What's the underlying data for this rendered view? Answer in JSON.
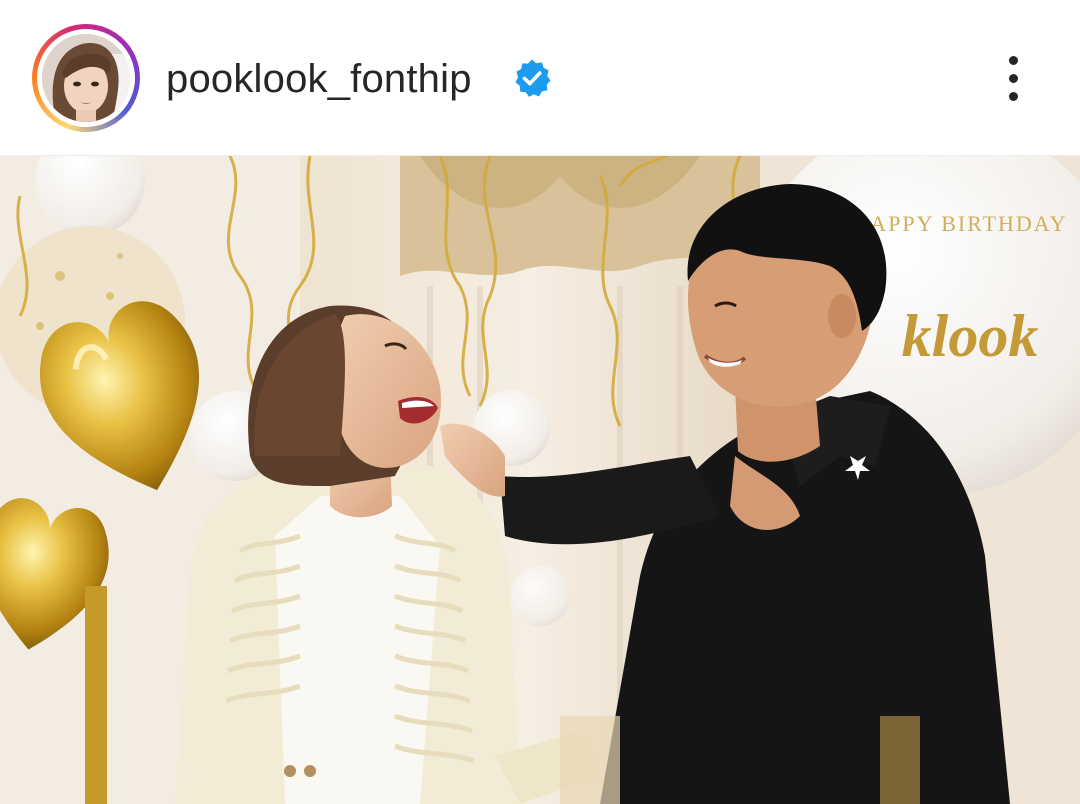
{
  "post": {
    "username": "pooklook_fonthip",
    "verified": true,
    "avatar": {
      "icon": "profile-photo",
      "ring_colors": [
        "#feda75",
        "#fa7e1e",
        "#d62976",
        "#962fbf",
        "#4f5bd5"
      ]
    },
    "verified_icon": "verified-badge-icon",
    "verified_color": "#1d9bf0",
    "more_icon": "more-options-icon",
    "photo": {
      "balloon_text_top": "HAPPY BIRTHDAY",
      "balloon_text_script": "klook"
    }
  }
}
